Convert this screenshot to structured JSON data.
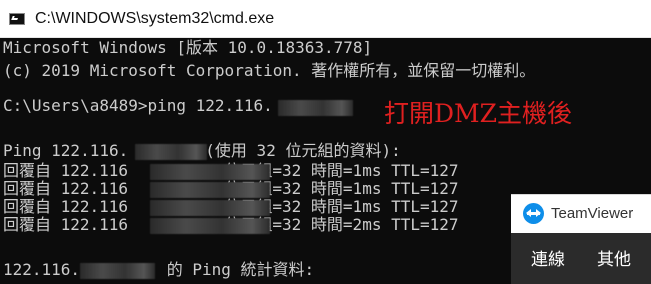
{
  "window": {
    "title": "C:\\WINDOWS\\system32\\cmd.exe",
    "icon": "cmd-icon"
  },
  "console": {
    "lines": [
      "Microsoft Windows [版本 10.0.18363.778]",
      "(c) 2019 Microsoft Corporation. 著作權所有，並保留一切權利。",
      "",
      "C:\\Users\\a8489>ping 122.116.",
      "",
      "Ping 122.116.        (使用 32 位元組的資料):",
      "回覆自 122.116          位元組=32 時間=1ms TTL=127",
      "回覆自 122.116          位元組=32 時間=1ms TTL=127",
      "回覆自 122.116          位元組=32 時間=1ms TTL=127",
      "回覆自 122.116          位元組=32 時間=2ms TTL=127",
      "",
      "122.116.         的 Ping 統計資料:"
    ]
  },
  "annotation": {
    "text": "打開DMZ主機後",
    "color": "#e02020"
  },
  "teamviewer": {
    "name": "TeamViewer",
    "connect_label": "連線",
    "other_label": "其他",
    "brand_color": "#0e8ee9"
  }
}
